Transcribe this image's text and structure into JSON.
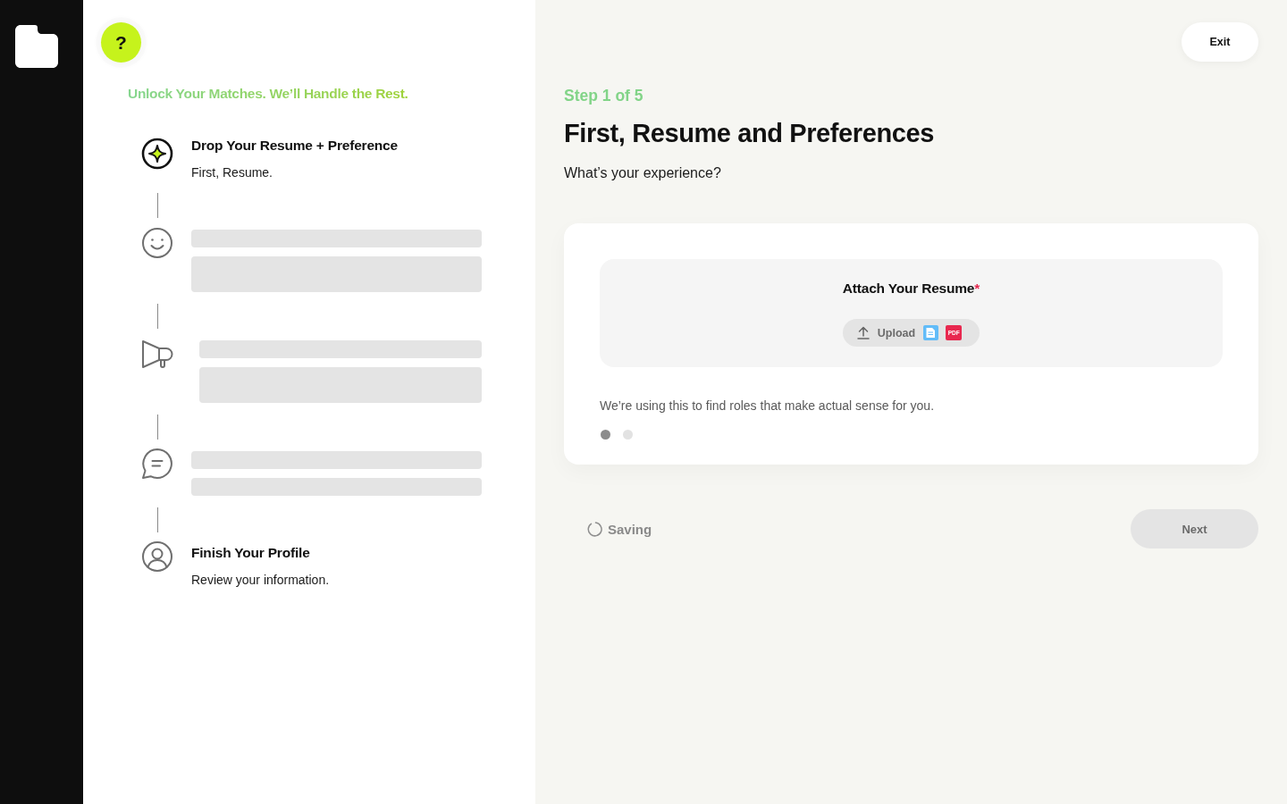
{
  "help_button": {
    "label": "?"
  },
  "tagline": "Unlock Your Matches. We’ll Handle the Rest.",
  "steps": [
    {
      "kind": "text",
      "active": true,
      "title": "Drop Your Resume + Preference",
      "subtitle": "First, Resume."
    },
    {
      "kind": "skeleton",
      "active": false
    },
    {
      "kind": "skeleton",
      "active": false
    },
    {
      "kind": "skeleton",
      "active": false
    },
    {
      "kind": "text",
      "active": false,
      "title": "Finish Your Profile",
      "subtitle": "Review your information."
    }
  ],
  "exit_button": "Exit",
  "step_label": "Step 1 of 5",
  "title": "First, Resume and Preferences",
  "question": "What’s your experience?",
  "card": {
    "upload": {
      "title": "Attach Your Resume",
      "required_mark": "*",
      "button": "Upload",
      "file_types": [
        {
          "kind": "word"
        },
        {
          "kind": "pdf",
          "label": "PDF"
        }
      ]
    },
    "note": "We’re using this to find roles that make actual sense for you.",
    "dots": [
      {
        "selected": true
      },
      {
        "selected": false
      }
    ]
  },
  "footer": {
    "status": "Saving",
    "next": {
      "label": "Next",
      "disabled": true
    }
  }
}
